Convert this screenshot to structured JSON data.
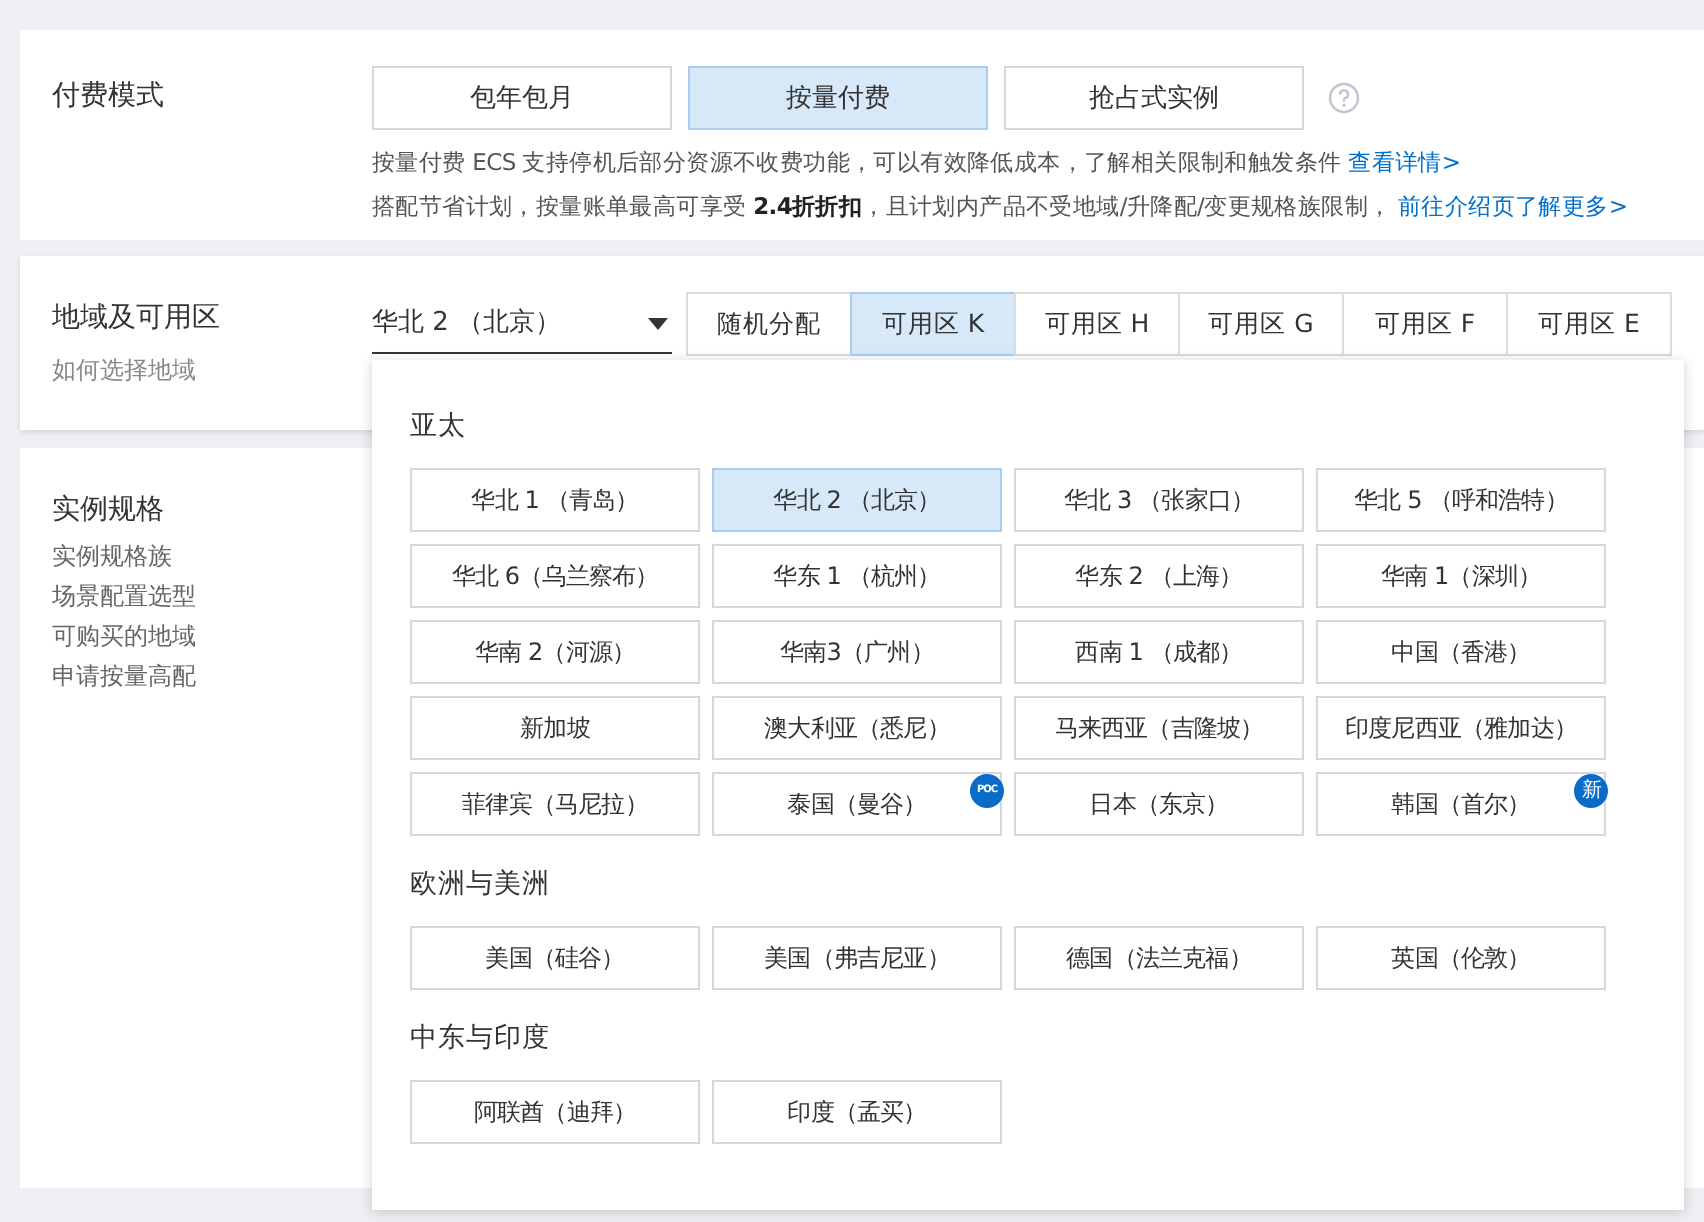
{
  "billing": {
    "label": "付费模式",
    "options": [
      {
        "label": "包年包月",
        "selected": false
      },
      {
        "label": "按量付费",
        "selected": true
      },
      {
        "label": "抢占式实例",
        "selected": false
      }
    ],
    "notes": [
      {
        "text": "按量付费 ECS 支持停机后部分资源不收费功能，可以有效降低成本，了解相关限制和触发条件",
        "link": "查看详情>"
      },
      {
        "text": "搭配节省计划，按量账单最高可享受 **2.4折折扣**，且计划内产品不受地域/升降配/变更规格族限制，",
        "link": "前往介绍页了解更多>"
      }
    ]
  },
  "region": {
    "label": "地域及可用区",
    "help_link": "如何选择地域",
    "select": {
      "value": "华北 2 （北京）"
    },
    "zones": [
      {
        "label": "随机分配",
        "selected": false
      },
      {
        "label": "可用区 K",
        "selected": true
      },
      {
        "label": "可用区 H",
        "selected": false
      },
      {
        "label": "可用区 G",
        "selected": false
      },
      {
        "label": "可用区 F",
        "selected": false
      },
      {
        "label": "可用区 E",
        "selected": false
      }
    ]
  },
  "region_dropdown": {
    "groups": [
      {
        "title": "亚太",
        "regions": [
          {
            "label": "华北 1 （青岛）",
            "selected": false
          },
          {
            "label": "华北 2 （北京）",
            "selected": true
          },
          {
            "label": "华北 3 （张家口）",
            "selected": false
          },
          {
            "label": "华北 5 （呼和浩特）",
            "selected": false
          },
          {
            "label": "华北 6（乌兰察布）",
            "selected": false
          },
          {
            "label": "华东 1 （杭州）",
            "selected": false
          },
          {
            "label": "华东 2 （上海）",
            "selected": false
          },
          {
            "label": "华南 1（深圳）",
            "selected": false
          },
          {
            "label": "华南 2（河源）",
            "selected": false
          },
          {
            "label": "华南3（广州）",
            "selected": false
          },
          {
            "label": "西南 1 （成都）",
            "selected": false
          },
          {
            "label": "中国（香港）",
            "selected": false
          },
          {
            "label": "新加坡",
            "selected": false
          },
          {
            "label": "澳大利亚（悉尼）",
            "selected": false
          },
          {
            "label": "马来西亚（吉隆坡）",
            "selected": false
          },
          {
            "label": "印度尼西亚（雅加达）",
            "selected": false
          },
          {
            "label": "菲律宾（马尼拉）",
            "selected": false
          },
          {
            "label": "泰国（曼谷）",
            "selected": false,
            "badge": "POC"
          },
          {
            "label": "日本（东京）",
            "selected": false
          },
          {
            "label": "韩国（首尔）",
            "selected": false,
            "badge": "新"
          }
        ]
      },
      {
        "title": "欧洲与美洲",
        "regions": [
          {
            "label": "美国（硅谷）",
            "selected": false
          },
          {
            "label": "美国（弗吉尼亚）",
            "selected": false
          },
          {
            "label": "德国（法兰克福）",
            "selected": false
          },
          {
            "label": "英国（伦敦）",
            "selected": false
          }
        ]
      },
      {
        "title": "中东与印度",
        "regions": [
          {
            "label": "阿联酋（迪拜）",
            "selected": false
          },
          {
            "label": "印度（孟买）",
            "selected": false
          }
        ]
      }
    ]
  },
  "instance": {
    "title": "实例规格",
    "links": [
      "实例规格族",
      "场景配置选型",
      "可购买的地域",
      "申请按量高配"
    ]
  }
}
